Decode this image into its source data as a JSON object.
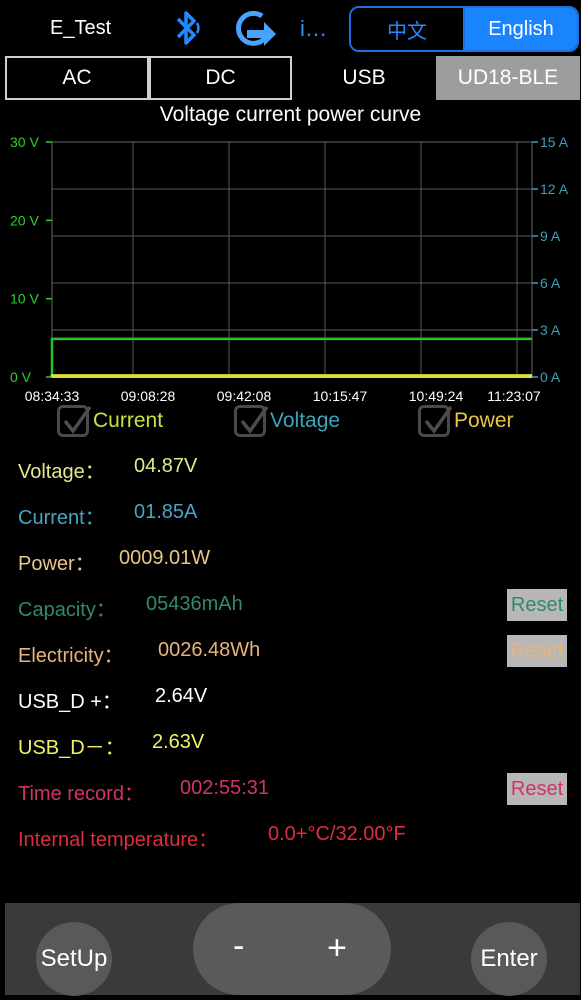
{
  "header": {
    "app_name": "E_Test",
    "info_label": "i...",
    "lang_zh": "中文",
    "lang_en": "English"
  },
  "tabs": [
    {
      "label": "AC"
    },
    {
      "label": "DC"
    },
    {
      "label": "USB"
    },
    {
      "label": "UD18-BLE",
      "active": true
    }
  ],
  "chart_data": {
    "type": "line",
    "title": "Voltage current power curve",
    "y_left": {
      "ticks": [
        "30 V",
        "20 V",
        "10 V",
        "0 V"
      ],
      "range": [
        0,
        30
      ],
      "color": "#2bd12b"
    },
    "y_right": {
      "ticks": [
        "15 A",
        "12 A",
        "9 A",
        "6 A",
        "3 A",
        "0 A"
      ],
      "range": [
        0,
        15
      ],
      "color": "#3aa0b8"
    },
    "x_ticks": [
      "08:34:33",
      "09:08:28",
      "09:42:08",
      "10:15:47",
      "10:49:24",
      "11:23:07"
    ],
    "grid": true,
    "series": [
      {
        "name": "Voltage",
        "color": "#25c52a",
        "values": [
          4.87,
          4.87,
          4.87,
          4.87,
          4.87,
          4.87
        ]
      },
      {
        "name": "Current",
        "color": "#d8e23a",
        "values": [
          0.2,
          0.2,
          0.2,
          0.2,
          0.2,
          0.2
        ]
      }
    ]
  },
  "checkboxes": [
    {
      "label": "Current",
      "color": "#c6e246"
    },
    {
      "label": "Voltage",
      "color": "#3ea3b9"
    },
    {
      "label": "Power",
      "color": "#e7c64a"
    }
  ],
  "readings": {
    "voltage": {
      "label": "Voltage：",
      "value": "04.87V",
      "color": "#e6e88c"
    },
    "current": {
      "label": "Current：",
      "value": "01.85A",
      "color": "#4aa3c4"
    },
    "power": {
      "label": "Power：",
      "value": "0009.01W",
      "color": "#e8c58a"
    },
    "capacity": {
      "label": "Capacity：",
      "value": "05436mAh",
      "color": "#2f8a70",
      "reset": "Reset"
    },
    "electricity": {
      "label": "Electricity：",
      "value": "0026.48Wh",
      "color": "#e8b47a",
      "reset": "Reset"
    },
    "usb_dp": {
      "label": "USB_D +：",
      "value": "2.64V",
      "color": "#ffffff"
    },
    "usb_dm": {
      "label": "USB_D－：",
      "value": "2.63V",
      "color": "#f4ef6a"
    },
    "time": {
      "label": "Time record：",
      "value": "002:55:31",
      "color": "#d0336a",
      "reset": "Reset"
    },
    "temp": {
      "label": "Internal temperature：",
      "value": "0.0+°C/32.00°F",
      "color": "#e02c3c"
    }
  },
  "bottom": {
    "setup": "SetUp",
    "minus": "-",
    "plus": "+",
    "enter": "Enter"
  }
}
